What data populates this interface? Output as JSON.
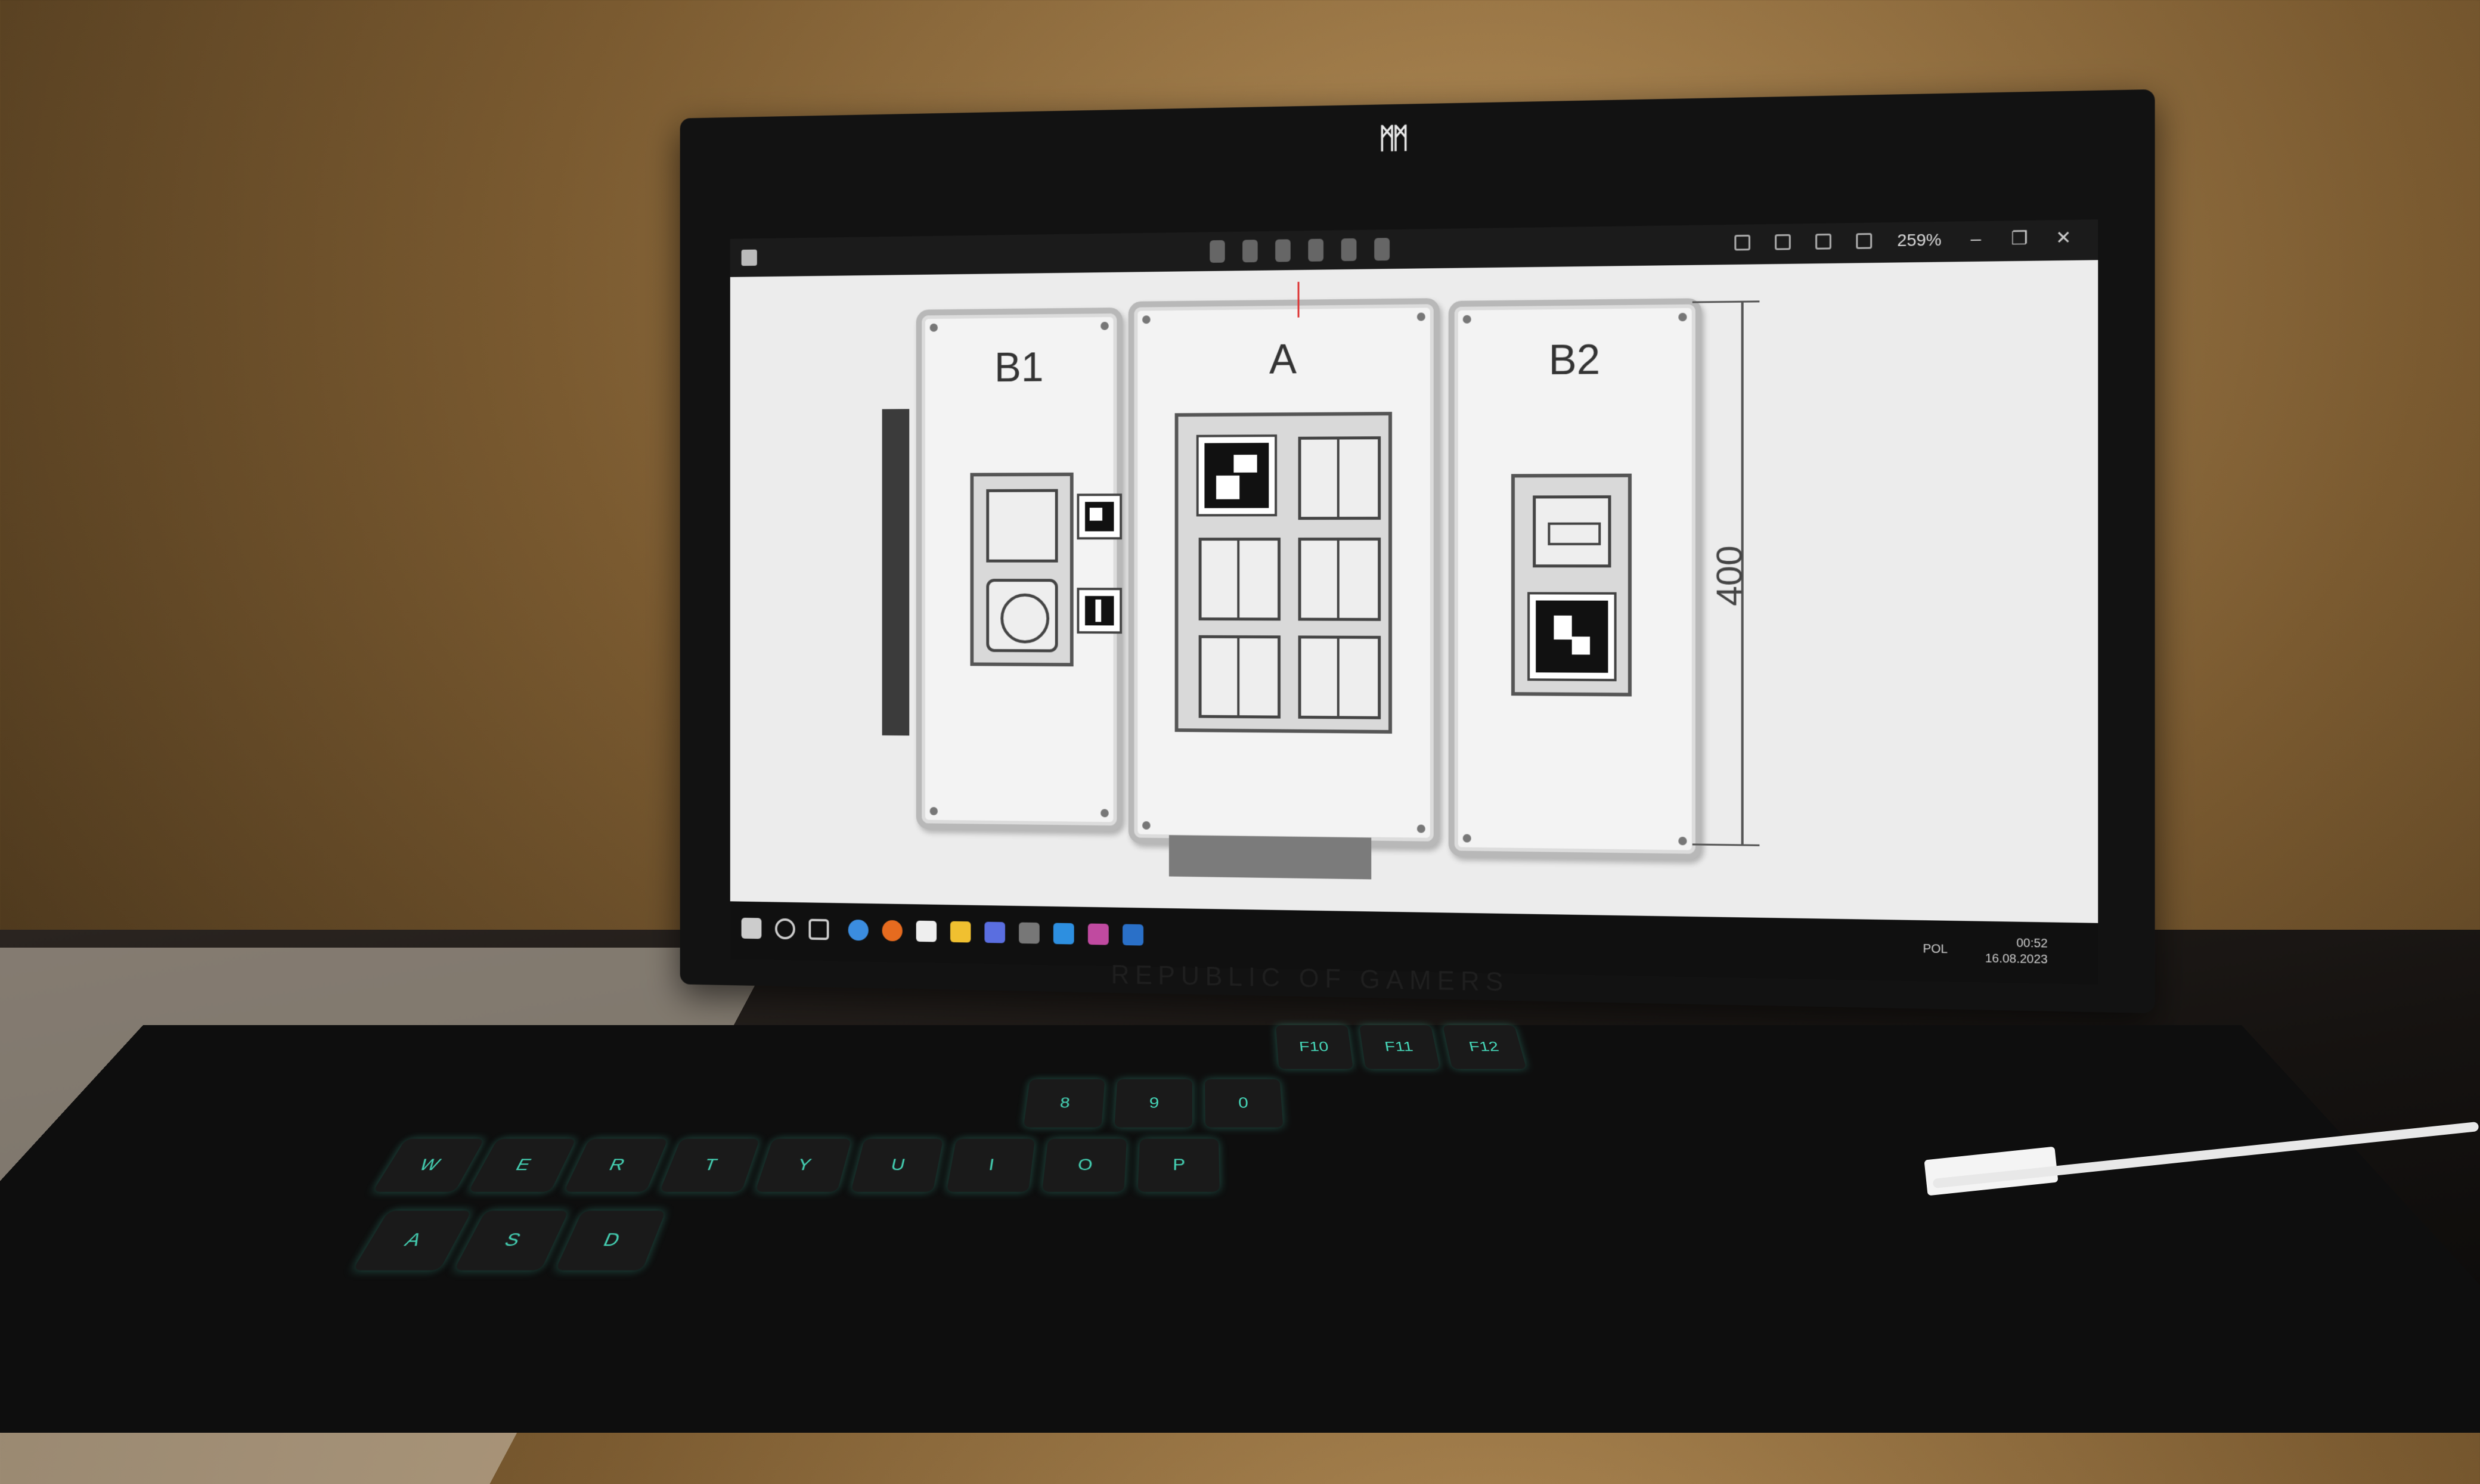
{
  "app": {
    "title": "",
    "zoom": "259%",
    "window_controls": [
      "–",
      "❐",
      "✕"
    ]
  },
  "drawing": {
    "panels": [
      {
        "label": "B1"
      },
      {
        "label": "A"
      },
      {
        "label": "B2"
      }
    ],
    "dimension": "400"
  },
  "taskbar": {
    "language": "POL",
    "time": "00:52",
    "date": "16.08.2023"
  },
  "laptop": {
    "bezel_text": "REPUBLIC OF GAMERS"
  },
  "keyboard": {
    "keys": [
      "W",
      "E",
      "R",
      "T",
      "Y",
      "U",
      "I",
      "O",
      "P",
      "A",
      "S",
      "D",
      "F10",
      "F11",
      "F12",
      "8",
      "9",
      "0"
    ]
  }
}
